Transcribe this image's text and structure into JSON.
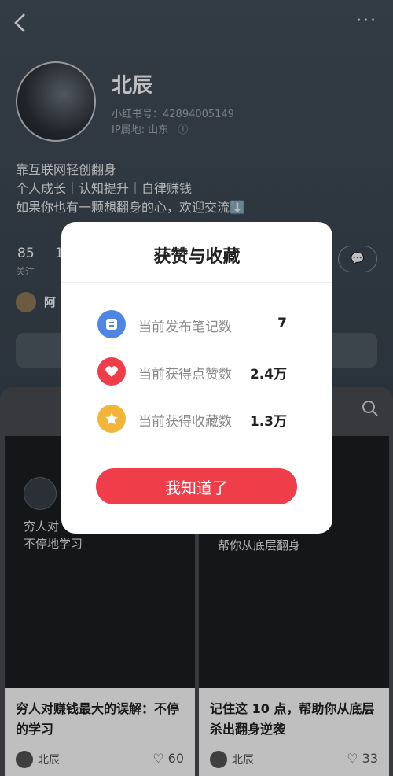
{
  "profile": {
    "name": "北辰",
    "id_line": "小红书号：42894005149",
    "ip_line": "IP属地: 山东",
    "bio": [
      "靠互联网轻创翻身",
      "个人成长｜认知提升｜自律赚钱",
      "如果你也有一颗想翻身的心，欢迎交流⬇️"
    ],
    "following_count": "85",
    "following_label": "关注",
    "second_count": "1",
    "friend_name": "阿"
  },
  "feed": {
    "cards": [
      {
        "image_text": [
          "穷人对",
          "不停地学习"
        ],
        "title": "穷人对赚钱最大的误解：不停的学习",
        "author": "北辰",
        "likes": "60"
      },
      {
        "image_text": [
          "帮你从底层翻身"
        ],
        "title": "记住这 10 点，帮助你从底层杀出翻身逆袭",
        "author": "北辰",
        "likes": "33"
      }
    ]
  },
  "modal": {
    "title": "获赞与收藏",
    "rows": [
      {
        "label": "当前发布笔记数",
        "value": "7",
        "icon": "note-icon",
        "color": "#4f86e6"
      },
      {
        "label": "当前获得点赞数",
        "value": "2.4万",
        "icon": "heart-icon",
        "color": "#ef3e4a"
      },
      {
        "label": "当前获得收藏数",
        "value": "1.3万",
        "icon": "star-icon",
        "color": "#f2b53a"
      }
    ],
    "button": "我知道了"
  },
  "colors": {
    "accent": "#ef3e4a"
  }
}
